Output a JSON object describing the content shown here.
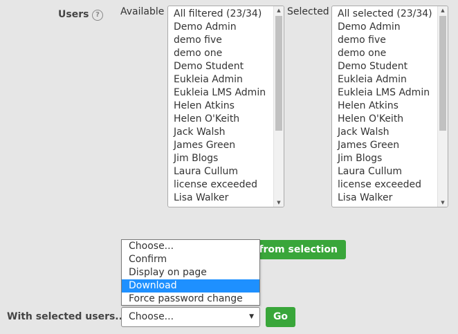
{
  "form": {
    "users_label": "Users",
    "help_icon": "question-circle-icon",
    "available_label": "Available",
    "selected_label": "Selected"
  },
  "available_list": {
    "items": [
      "All filtered (23/34)",
      "Demo Admin",
      "demo five",
      "demo one",
      "Demo Student",
      "Eukleia Admin",
      "Eukleia LMS Admin",
      "Helen Atkins",
      "Helen O'Keith",
      "Jack Walsh",
      "James Green",
      "Jim Blogs",
      "Laura Cullum",
      "license exceeded",
      "Lisa Walker"
    ]
  },
  "selected_list": {
    "items": [
      "All selected (23/34)",
      "Demo Admin",
      "demo five",
      "demo one",
      "Demo Student",
      "Eukleia Admin",
      "Eukleia LMS Admin",
      "Helen Atkins",
      "Helen O'Keith",
      "Jack Walsh",
      "James Green",
      "Jim Blogs",
      "Laura Cullum",
      "license exceeded",
      "Lisa Walker"
    ]
  },
  "remove_button": {
    "label": "e from selection"
  },
  "dropdown": {
    "options": [
      "Choose...",
      "Confirm",
      "Display on page",
      "Download",
      "Force password change"
    ],
    "highlighted": "Download"
  },
  "bulk_action": {
    "label": "With selected users...",
    "selected_value": "Choose...",
    "go_label": "Go"
  },
  "colors": {
    "background": "#e6e6e6",
    "accent_green": "#39a63a",
    "highlight_blue": "#1e90ff"
  }
}
